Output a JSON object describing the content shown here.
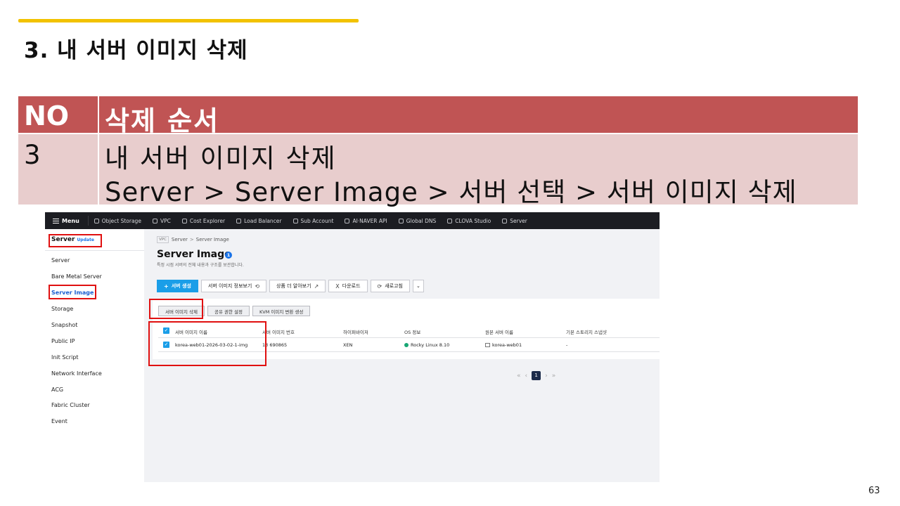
{
  "slide": {
    "title": "3. 내 서버 이미지 삭제",
    "page_number": "63",
    "accent_color": "#f2c200"
  },
  "step_table": {
    "header_no": "NO",
    "header_order": "삭제 순서",
    "row_no": "3",
    "row_line1": "내 서버 이미지 삭제",
    "row_line2": "Server > Server Image > 서버 선택 > 서버 이미지 삭제",
    "header_color": "#c05454",
    "body_color": "#e8cdcd"
  },
  "console": {
    "topnav": {
      "menu_label": "Menu",
      "items": [
        "Object Storage",
        "VPC",
        "Cost Explorer",
        "Load Balancer",
        "Sub Account",
        "AI·NAVER API",
        "Global DNS",
        "CLOVA Studio",
        "Server"
      ]
    },
    "sidebar": {
      "title": "Server",
      "update_badge": "Update",
      "items": [
        "Server",
        "Bare Metal Server",
        "Server Image",
        "Storage",
        "Snapshot",
        "Public IP",
        "Init Script",
        "Network Interface",
        "ACG",
        "Fabric Cluster",
        "Event"
      ],
      "active_index": 2
    },
    "breadcrumb": {
      "badge": "VPC",
      "items": [
        "Server",
        "Server Image"
      ]
    },
    "page": {
      "title": "Server Image",
      "count": "1",
      "description": "특정 시점 서버의 전체 내용과 구조를 보관합니다."
    },
    "toolbar": {
      "create": "서버 생성",
      "info": "서버 이미지 정보보기",
      "learn": "상품 더 알아보기",
      "download": "다운로드",
      "refresh": "새로고침"
    },
    "sub_toolbar": {
      "delete": "서버 이미지 삭제",
      "share": "공유 권한 설정",
      "kvm": "KVM 이미지 변환 생성"
    },
    "table": {
      "columns": [
        "서버 이미지 이름",
        "서버 이미지 번호",
        "하이퍼바이저",
        "OS 정보",
        "원본 서버 이름",
        "기본 스토리지 스냅샷"
      ],
      "row": {
        "name": "korea-web01-2026-03-02-1-img",
        "number": "13  690865",
        "hypervisor": "XEN",
        "os": "Rocky Linux 8.10",
        "origin_server": "korea-web01",
        "snapshot": "-"
      }
    },
    "pagination": {
      "current": "1"
    },
    "highlight_color": "#e01010"
  }
}
